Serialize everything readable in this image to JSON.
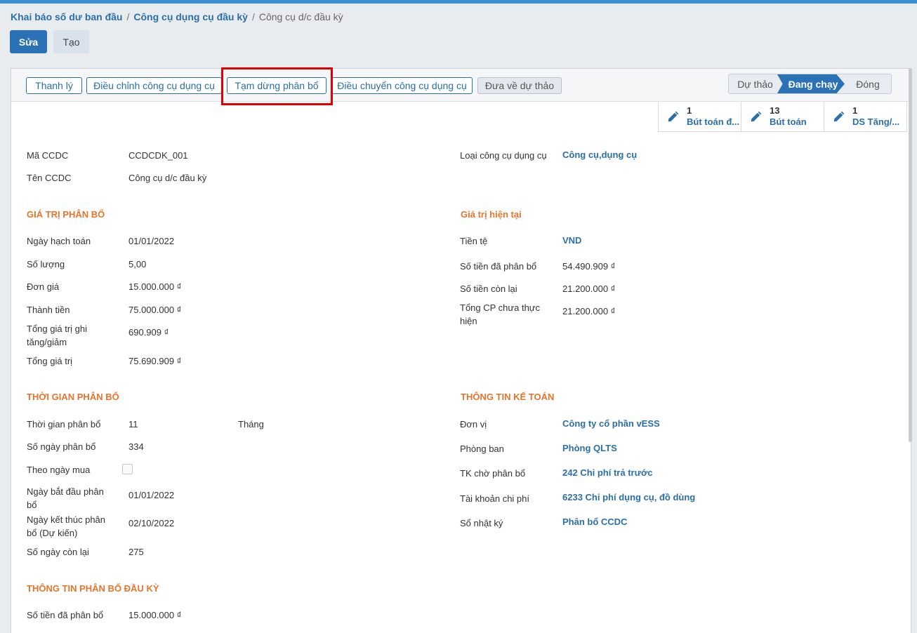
{
  "breadcrumb": {
    "item1": "Khai báo số dư ban đầu",
    "item2": "Công cụ dụng cụ đầu kỳ",
    "current": "Công cụ d/c đầu kỳ",
    "sep": "/"
  },
  "control": {
    "edit": "Sửa",
    "create": "Tạo"
  },
  "actions": {
    "liquidate": "Thanh lý",
    "adjust": "Điều chỉnh công cụ dụng cụ",
    "pause": "Tạm dừng phân bổ",
    "transfer": "Điều chuyển công cụ dụng cụ",
    "to_draft": "Đưa về dự thảo"
  },
  "stages": {
    "draft": "Dự thảo",
    "running": "Đang chạy",
    "closed": "Đóng",
    "active": "Đang chạy"
  },
  "smart_buttons": [
    {
      "count": "1",
      "label": "Bút toán đ..."
    },
    {
      "count": "13",
      "label": "Bút toán"
    },
    {
      "count": "1",
      "label": "DS Tăng/..."
    }
  ],
  "form": {
    "code_label": "Mã CCDC",
    "code": "CCDCDK_001",
    "name_label": "Tên CCDC",
    "name": "Công cụ d/c đầu kỳ",
    "type_label": "Loại công cụ dụng cụ",
    "type": "Công cụ,dụng cụ",
    "sec_value": "GIÁ TRỊ PHÂN BỔ",
    "acc_date_label": "Ngày hạch toán",
    "acc_date": "01/01/2022",
    "qty_label": "Số lượng",
    "qty": "5,00",
    "unit_price_label": "Đơn giá",
    "unit_price": "15.000.000 ₫",
    "amount_label": "Thành tiền",
    "amount": "75.000.000 ₫",
    "adj_total_label": "Tổng giá trị ghi tăng/giảm",
    "adj_total": "690.909 ₫",
    "total_label": "Tổng giá trị",
    "total": "75.690.909 ₫",
    "sec_current": "Giá trị hiện tại",
    "currency_label": "Tiền tệ",
    "currency": "VND",
    "allocated_label": "Số tiền đã phân bổ",
    "allocated": "54.490.909 ₫",
    "remaining_label": "Số tiền còn lại",
    "remaining": "21.200.000 ₫",
    "unrealized_label": "Tổng CP chưa thực hiện",
    "unrealized": "21.200.000 ₫",
    "sec_time": "THỜI GIAN PHÂN BỔ",
    "period_label": "Thời gian phân bổ",
    "period": "11",
    "period_unit": "Tháng",
    "days_label": "Số ngày phân bổ",
    "days": "334",
    "by_purchase_label": "Theo ngày mua",
    "start_label": "Ngày bắt đầu phân bổ",
    "start": "01/01/2022",
    "end_label": "Ngày kết thúc phân bổ (Dự kiến)",
    "end": "02/10/2022",
    "days_left_label": "Số ngày còn lại",
    "days_left": "275",
    "sec_accounting": "THÔNG TIN KẾ TOÁN",
    "company_label": "Đơn vị",
    "company": "Công ty cổ phần vESS",
    "dept_label": "Phòng ban",
    "dept": "Phòng QLTS",
    "prepaid_label": "TK chờ phân bổ",
    "prepaid": "242 Chi phí trả trước",
    "expense_label": "Tài khoản chi phí",
    "expense": "6233 Chi phí dụng cụ, đồ dùng",
    "journal_label": "Sổ nhật ký",
    "journal": "Phân bổ CCDC",
    "sec_opening": "THÔNG TIN PHÂN BỔ ĐẦU KỲ",
    "opening_alloc_label": "Số tiền đã phân bổ",
    "opening_alloc": "15.000.000 ₫"
  },
  "colors": {
    "primary": "#2a72b5",
    "section": "#e8742c",
    "highlight": "#e00000"
  }
}
